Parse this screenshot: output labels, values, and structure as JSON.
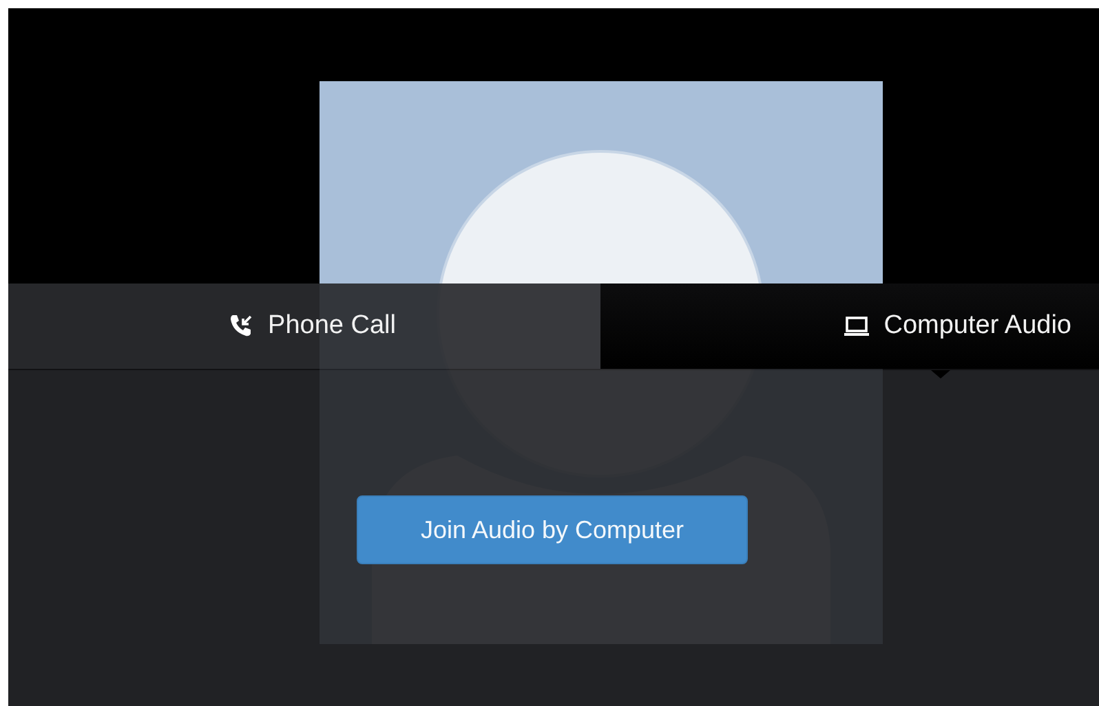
{
  "tabs": [
    {
      "kind": "phone",
      "label": "Phone Call",
      "selected": false
    },
    {
      "kind": "computer",
      "label": "Computer Audio",
      "selected": true
    }
  ],
  "join_button": {
    "label": "Join Audio by Computer"
  }
}
